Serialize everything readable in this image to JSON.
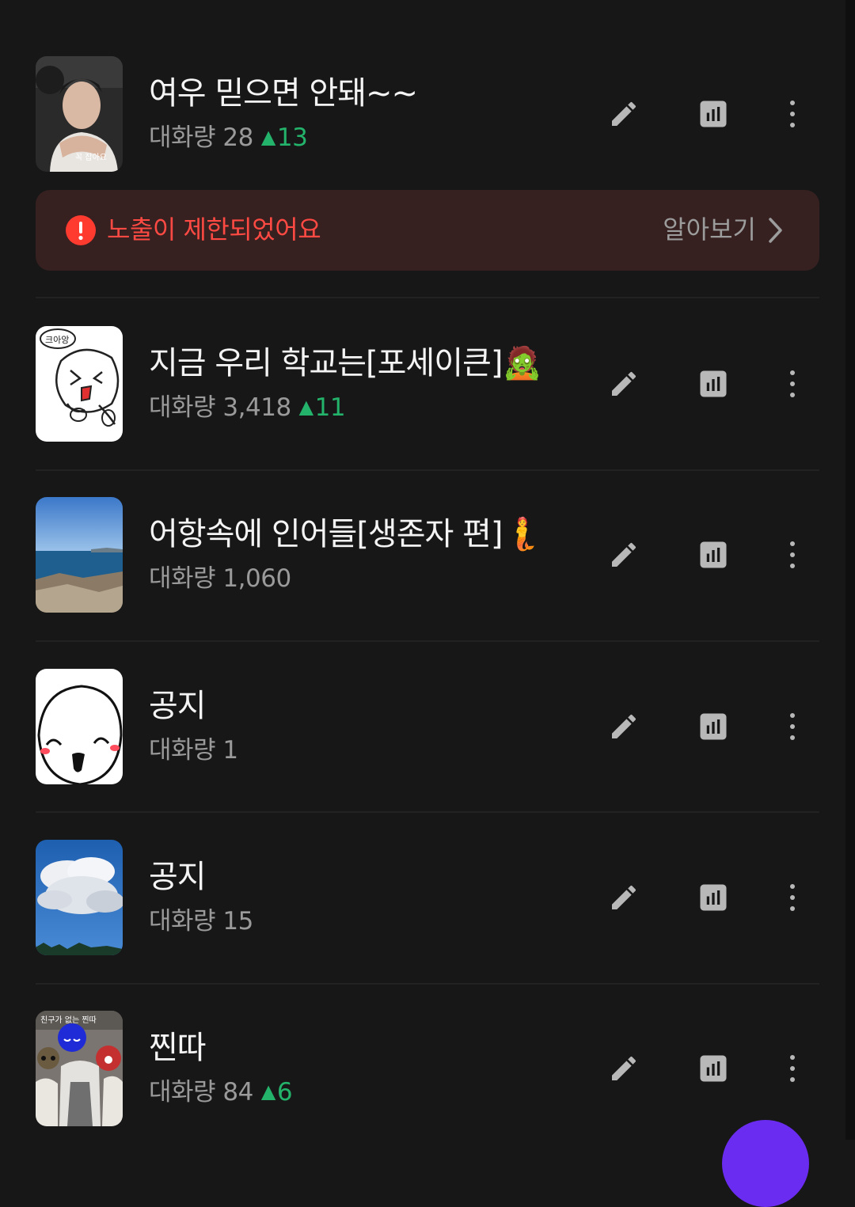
{
  "items": [
    {
      "title": "여우 믿으면 안돼~~",
      "stats_label": "대화량",
      "count": "28",
      "delta": "13",
      "thumb_text": "꼭 잡아요"
    },
    {
      "title": "지금 우리 학교는[포세이큰]🧟",
      "stats_label": "대화량",
      "count": "3,418",
      "delta": "11",
      "thumb_text": "크아앙"
    },
    {
      "title": "어항속에 인어들[생존자 편]🧜",
      "stats_label": "대화량",
      "count": "1,060",
      "delta": ""
    },
    {
      "title": "공지",
      "stats_label": "대화량",
      "count": "1",
      "delta": ""
    },
    {
      "title": "공지",
      "stats_label": "대화량",
      "count": "15",
      "delta": ""
    },
    {
      "title": "찐따",
      "stats_label": "대화량",
      "count": "84",
      "delta": "6",
      "thumb_text": "친구가 없는 찐따"
    }
  ],
  "notice": {
    "message": "노출이 제한되었어요",
    "action": "알아보기"
  },
  "icons": {
    "edit": "pencil-icon",
    "stats": "bar-chart-icon",
    "more": "more-vertical-icon",
    "alert": "alert-circle-icon",
    "chevron": "chevron-right-icon"
  },
  "colors": {
    "background": "#171717",
    "delta_green": "#24b36b",
    "alert_red": "#ff4a43",
    "notice_bg": "#362020",
    "fab_purple": "#6a2cf0"
  }
}
